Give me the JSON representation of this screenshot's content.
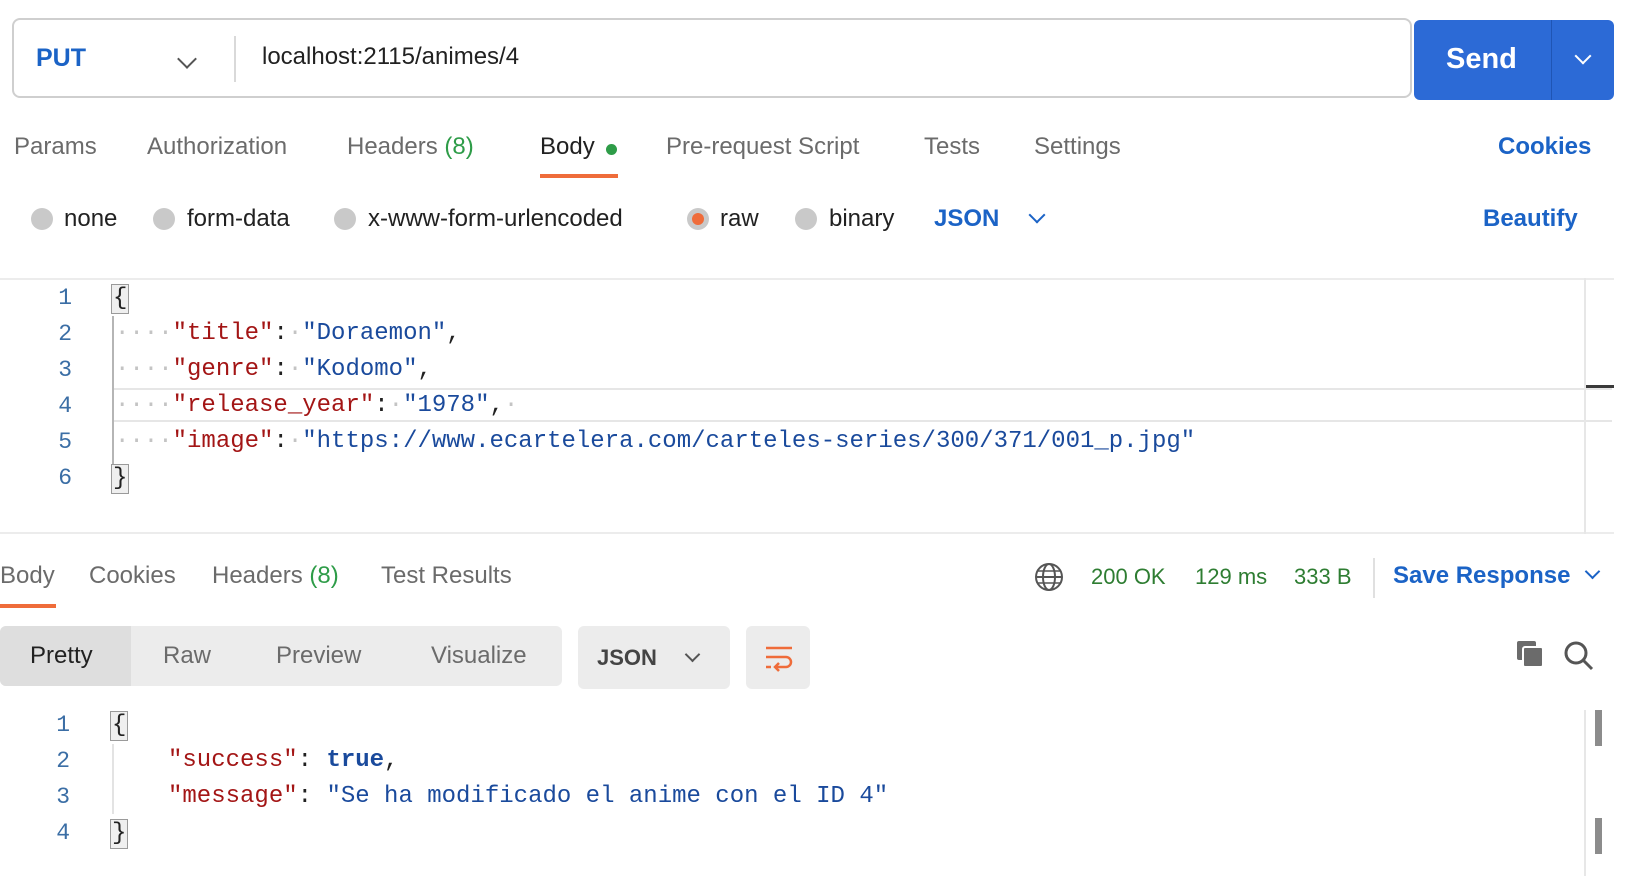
{
  "request": {
    "method": "PUT",
    "url": "localhost:2115/animes/4",
    "send_label": "Send"
  },
  "request_tabs": {
    "params": "Params",
    "authorization": "Authorization",
    "headers": "Headers",
    "headers_count": "(8)",
    "body": "Body",
    "prerequest": "Pre-request Script",
    "tests": "Tests",
    "settings": "Settings",
    "cookies": "Cookies"
  },
  "body_types": {
    "none": "none",
    "form_data": "form-data",
    "urlencoded": "x-www-form-urlencoded",
    "raw": "raw",
    "binary": "binary",
    "selected": "raw",
    "format": "JSON",
    "beautify": "Beautify"
  },
  "request_body": {
    "line_numbers": [
      "1",
      "2",
      "3",
      "4",
      "5",
      "6"
    ],
    "open": "{",
    "close": "}",
    "fields": [
      {
        "key": "\"title\"",
        "value": "\"Doraemon\"",
        "trail": ","
      },
      {
        "key": "\"genre\"",
        "value": "\"Kodomo\"",
        "trail": ","
      },
      {
        "key": "\"release_year\"",
        "value": "\"1978\"",
        "trail": ","
      },
      {
        "key": "\"image\"",
        "value": "\"https://www.ecartelera.com/carteles-series/300/371/001_p.jpg\"",
        "trail": ""
      }
    ]
  },
  "response_tabs": {
    "body": "Body",
    "cookies": "Cookies",
    "headers": "Headers",
    "headers_count": "(8)",
    "test_results": "Test Results"
  },
  "response_status": {
    "status": "200 OK",
    "time": "129 ms",
    "size": "333 B",
    "save_response": "Save Response"
  },
  "response_view": {
    "pretty": "Pretty",
    "raw": "Raw",
    "preview": "Preview",
    "visualize": "Visualize",
    "format": "JSON"
  },
  "response_body": {
    "line_numbers": [
      "1",
      "2",
      "3",
      "4"
    ],
    "open": "{",
    "close": "}",
    "success_key": "\"success\"",
    "success_value": "true",
    "message_key": "\"message\"",
    "message_value": "\"Se ha modificado el anime con el ID 4\""
  },
  "colors": {
    "accent_blue": "#2c6ad6",
    "link_blue": "#1b63c6",
    "active_tab": "#ef6c3a",
    "success_green": "#2e7d32"
  },
  "icons": [
    "chevron-down-icon",
    "globe-icon",
    "copy-icon",
    "search-icon",
    "wrap-lines-icon"
  ]
}
